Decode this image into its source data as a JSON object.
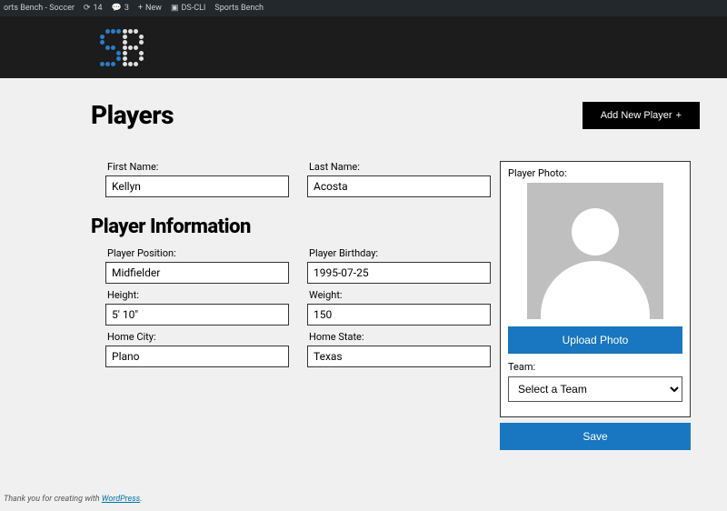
{
  "admin_bar": {
    "site_title": "orts Bench - Soccer",
    "updates": "14",
    "comments": "3",
    "new": "New",
    "ds_cli": "DS-CLI",
    "sports_bench": "Sports Bench"
  },
  "page": {
    "title": "Players",
    "add_button": "Add New Player"
  },
  "fields": {
    "first_name": {
      "label": "First Name:",
      "value": "Kellyn"
    },
    "last_name": {
      "label": "Last Name:",
      "value": "Acosta"
    },
    "position": {
      "label": "Player Position:",
      "value": "Midfielder"
    },
    "birthday": {
      "label": "Player Birthday:",
      "value": "1995-07-25"
    },
    "height": {
      "label": "Height:",
      "value": "5' 10\""
    },
    "weight": {
      "label": "Weight:",
      "value": "150"
    },
    "home_city": {
      "label": "Home City:",
      "value": "Plano"
    },
    "home_state": {
      "label": "Home State:",
      "value": "Texas"
    }
  },
  "section_heading": "Player Information",
  "sidebar": {
    "photo_label": "Player Photo:",
    "upload_button": "Upload Photo",
    "team_label": "Team:",
    "team_selected": "Select a Team",
    "save_button": "Save"
  },
  "footer": {
    "text": "Thank you for creating with ",
    "link": "WordPress"
  }
}
